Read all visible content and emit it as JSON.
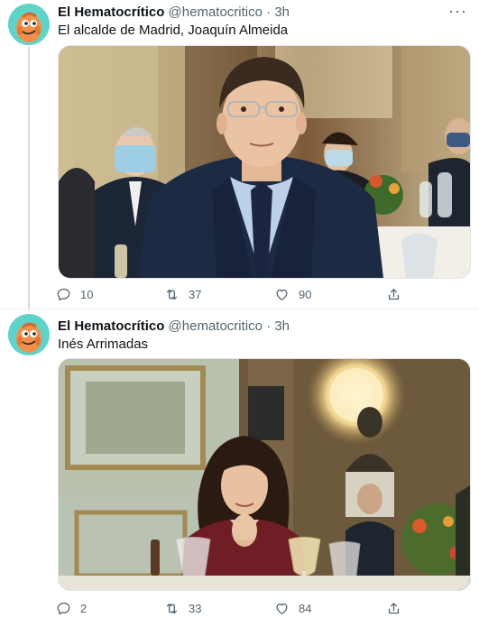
{
  "tweets": [
    {
      "author": {
        "name": "El Hematocrítico",
        "handle": "@hematocritico",
        "avatar_icon": "orange-cartoon-face-avatar"
      },
      "separator": "·",
      "time": "3h",
      "more_label": "···",
      "text": "El alcalde de Madrid, Joaquín Almeida",
      "actions": {
        "reply_count": "10",
        "retweet_count": "37",
        "like_count": "90"
      }
    },
    {
      "author": {
        "name": "El Hematocrítico",
        "handle": "@hematocritico",
        "avatar_icon": "orange-cartoon-face-avatar"
      },
      "separator": "·",
      "time": "3h",
      "more_label": "",
      "text": "Inés Arrimadas",
      "actions": {
        "reply_count": "2",
        "retweet_count": "33",
        "like_count": "84"
      }
    }
  ],
  "colors": {
    "text_primary": "#0f1419",
    "text_secondary": "#536471",
    "thread_line": "#cfd9de",
    "avatar_bg": "#5fd3c7",
    "avatar_face": "#f0904a"
  }
}
